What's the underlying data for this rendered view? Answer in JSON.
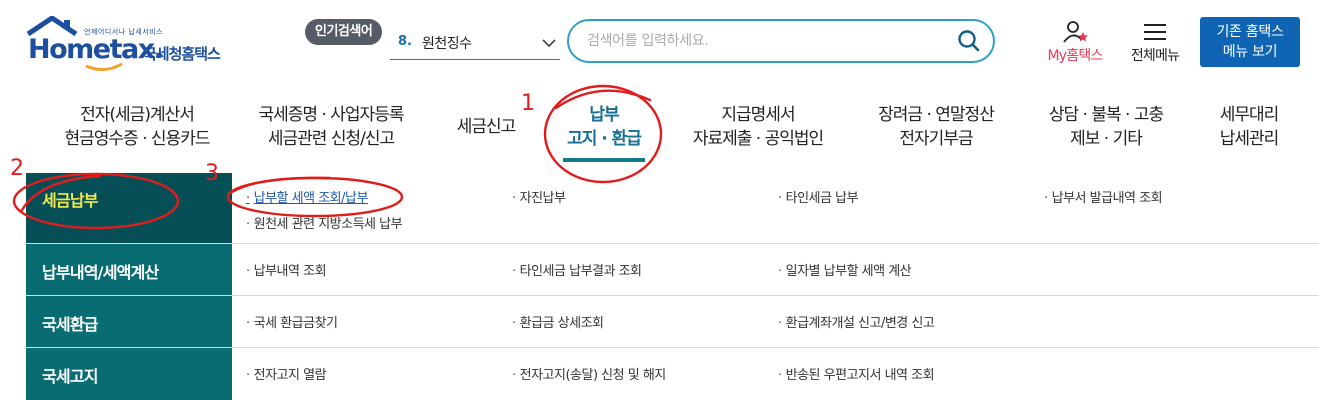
{
  "header": {
    "logo": {
      "tagline": "언제어디서나 납세서비스",
      "wordmark": "Hometax.",
      "korean_name": "국세청홈택스"
    },
    "popular": {
      "badge": "인기검색어",
      "rank": "8.",
      "term": "원천징수"
    },
    "search": {
      "placeholder": "검색어를 입력하세요."
    },
    "my_hometax_label": "My홈택스",
    "all_menu_label": "전체메뉴",
    "old_hometax": {
      "line1": "기존 홈택스",
      "line2": "메뉴 보기"
    }
  },
  "gnb": {
    "items": [
      {
        "line1": "전자(세금)계산서",
        "line2": "현금영수증 · 신용카드"
      },
      {
        "line1": "국세증명 · 사업자등록",
        "line2": "세금관련 신청/신고"
      },
      {
        "line1": "세금신고",
        "line2": ""
      },
      {
        "line1": "납부",
        "line2": "고지 · 환급"
      },
      {
        "line1": "지급명세서",
        "line2": "자료제출 · 공익법인"
      },
      {
        "line1": "장려금 · 연말정산",
        "line2": "전자기부금"
      },
      {
        "line1": "상담 · 불복 · 고충",
        "line2": "제보 · 기타"
      },
      {
        "line1": "세무대리",
        "line2": "납세관리"
      }
    ],
    "active_index": 3
  },
  "submenu": {
    "rows": [
      {
        "category": "세금납부",
        "links": [
          "납부할 세액 조회/납부",
          "자진납부",
          "타인세금 납부",
          "납부서 발급내역 조회",
          "원천세 관련 지방소득세 납부"
        ]
      },
      {
        "category": "납부내역/세액계산",
        "links": [
          "납부내역 조회",
          "타인세금 납부결과 조회",
          "일자별 납부할 세액 계산"
        ]
      },
      {
        "category": "국세환급",
        "links": [
          "국세 환급금찾기",
          "환급금 상세조회",
          "환급계좌개설 신고/변경 신고"
        ]
      },
      {
        "category": "국세고지",
        "links": [
          "전자고지 열람",
          "전자고지(송달) 신청 및 해지",
          "반송된 우편고지서 내역 조회"
        ]
      }
    ],
    "selected_row": 0,
    "selected_link": 0
  },
  "annotations": {
    "mark1": "1",
    "mark2": "2",
    "mark3": "3"
  },
  "colors": {
    "brand_blue": "#1d4fa0",
    "search_border": "#2e9fc9",
    "category_bg": "#096c73",
    "category_selected_bg": "#064f57",
    "category_selected_text": "#f2e84a",
    "my_hometax_red": "#e43a53",
    "old_button_bg": "#0f65b3",
    "annotation_red": "#e01d1d"
  },
  "icons": [
    "house-logo",
    "chevron-down-icon",
    "search-icon",
    "user-star-icon",
    "hamburger-menu-icon"
  ]
}
